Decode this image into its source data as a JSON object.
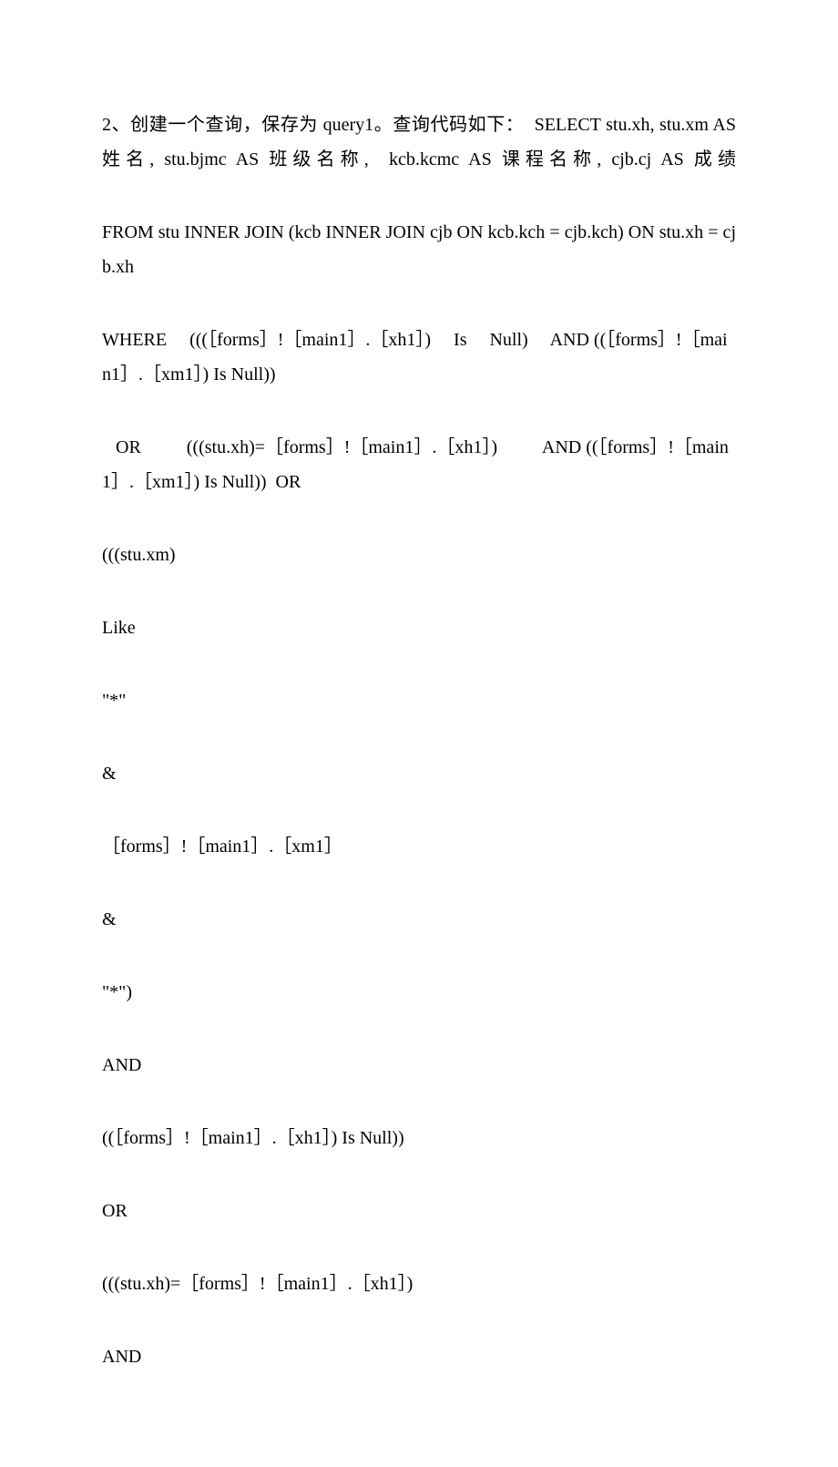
{
  "paragraphs": [
    {
      "text": "2、创建一个查询，保存为 query1。查询代码如下：  SELECT stu.xh, stu.xm AS 姓名, stu.bjmc AS 班级名称,  kcb.kcmc AS 课程名称, cjb.cj AS 成绩",
      "justify": true
    },
    {
      "text": "FROM stu INNER JOIN (kcb INNER JOIN cjb ON kcb.kch = cjb.kch) ON stu.xh = cjb.xh",
      "justify": true
    },
    {
      "text": "WHERE     (((［forms］!［main1］.［xh1］)     Is     Null)     AND ((［forms］!［main1］.［xm1］) Is Null))",
      "justify": false
    },
    {
      "text": " OR          (((stu.xh)=［forms］!［main1］.［xh1］)          AND ((［forms］!［main1］.［xm1］) Is Null))  OR",
      "justify": false,
      "indent": true
    },
    {
      "text": "(((stu.xm)",
      "justify": false
    },
    {
      "text": "Like",
      "justify": false
    },
    {
      "text": "\"*\"",
      "justify": false
    },
    {
      "text": "&",
      "justify": false
    },
    {
      "text": "［forms］!［main1］.［xm1］",
      "justify": false
    },
    {
      "text": "&",
      "justify": false
    },
    {
      "text": "\"*\")",
      "justify": false
    },
    {
      "text": "AND",
      "justify": false
    },
    {
      "text": "((［forms］!［main1］.［xh1］) Is Null))",
      "justify": false
    },
    {
      "text": "OR",
      "justify": false
    },
    {
      "text": "(((stu.xh)=［forms］!［main1］.［xh1］)",
      "justify": false
    },
    {
      "text": "AND",
      "justify": false
    }
  ]
}
